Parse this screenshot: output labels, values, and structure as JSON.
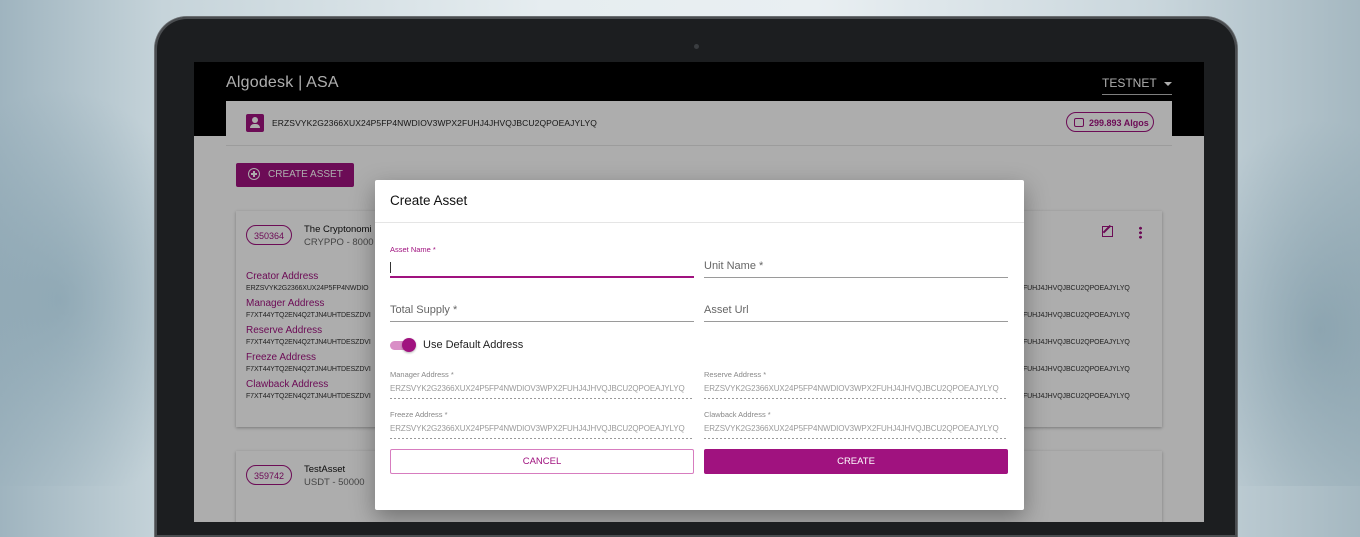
{
  "app": {
    "title": "Algodesk | ASA",
    "network": "TESTNET"
  },
  "account": {
    "address": "ERZSVYK2G2366XUX24P5FP4NWDIOV3WPX2FUHJ4JHVQJBCU2QPOEAJYLYQ",
    "balance": "299.893 Algos"
  },
  "toolbar": {
    "create_asset_label": "CREATE ASSET"
  },
  "assets": [
    {
      "id": "350364",
      "name": "The Cryptonomi",
      "unit": "CRYPPO - 8000",
      "fields": [
        {
          "label": "Creator Address",
          "value": "ERZSVYK2G2366XUX24P5FP4NWDIO",
          "value_right": "FUHJ4JHVQJBCU2QPOEAJYLYQ"
        },
        {
          "label": "Manager Address",
          "value": "F7XT44YTQ2EN4Q2TJN4UHTDESZDVI",
          "value_right": "FUHJ4JHVQJBCU2QPOEAJYLYQ"
        },
        {
          "label": "Reserve Address",
          "value": "F7XT44YTQ2EN4Q2TJN4UHTDESZDVI",
          "value_right": "FUHJ4JHVQJBCU2QPOEAJYLYQ"
        },
        {
          "label": "Freeze Address",
          "value": "F7XT44YTQ2EN4Q2TJN4UHTDESZDVI",
          "value_right": "FUHJ4JHVQJBCU2QPOEAJYLYQ"
        },
        {
          "label": "Clawback Address",
          "value": "F7XT44YTQ2EN4Q2TJN4UHTDESZDVI",
          "value_right": "FUHJ4JHVQJBCU2QPOEAJYLYQ"
        }
      ]
    },
    {
      "id": "359742",
      "name": "TestAsset",
      "unit": "USDT - 50000"
    }
  ],
  "dialog": {
    "title": "Create Asset",
    "asset_name_label": "Asset Name *",
    "unit_name_label": "Unit Name *",
    "total_supply_label": "Total Supply *",
    "asset_url_label": "Asset Url",
    "use_default_label": "Use Default Address",
    "use_default_checked": true,
    "manager_label": "Manager Address *",
    "manager_value": "ERZSVYK2G2366XUX24P5FP4NWDIOV3WPX2FUHJ4JHVQJBCU2QPOEAJYLYQ",
    "reserve_label": "Reserve Address *",
    "reserve_value": "ERZSVYK2G2366XUX24P5FP4NWDIOV3WPX2FUHJ4JHVQJBCU2QPOEAJYLYQ",
    "freeze_label": "Freeze Address *",
    "freeze_value": "ERZSVYK2G2366XUX24P5FP4NWDIOV3WPX2FUHJ4JHVQJBCU2QPOEAJYLYQ",
    "clawback_label": "Clawback Address *",
    "clawback_value": "ERZSVYK2G2366XUX24P5FP4NWDIOV3WPX2FUHJ4JHVQJBCU2QPOEAJYLYQ",
    "cancel_label": "CANCEL",
    "create_label": "CREATE"
  },
  "colors": {
    "accent": "#a0127f",
    "appbar": "#000000"
  }
}
